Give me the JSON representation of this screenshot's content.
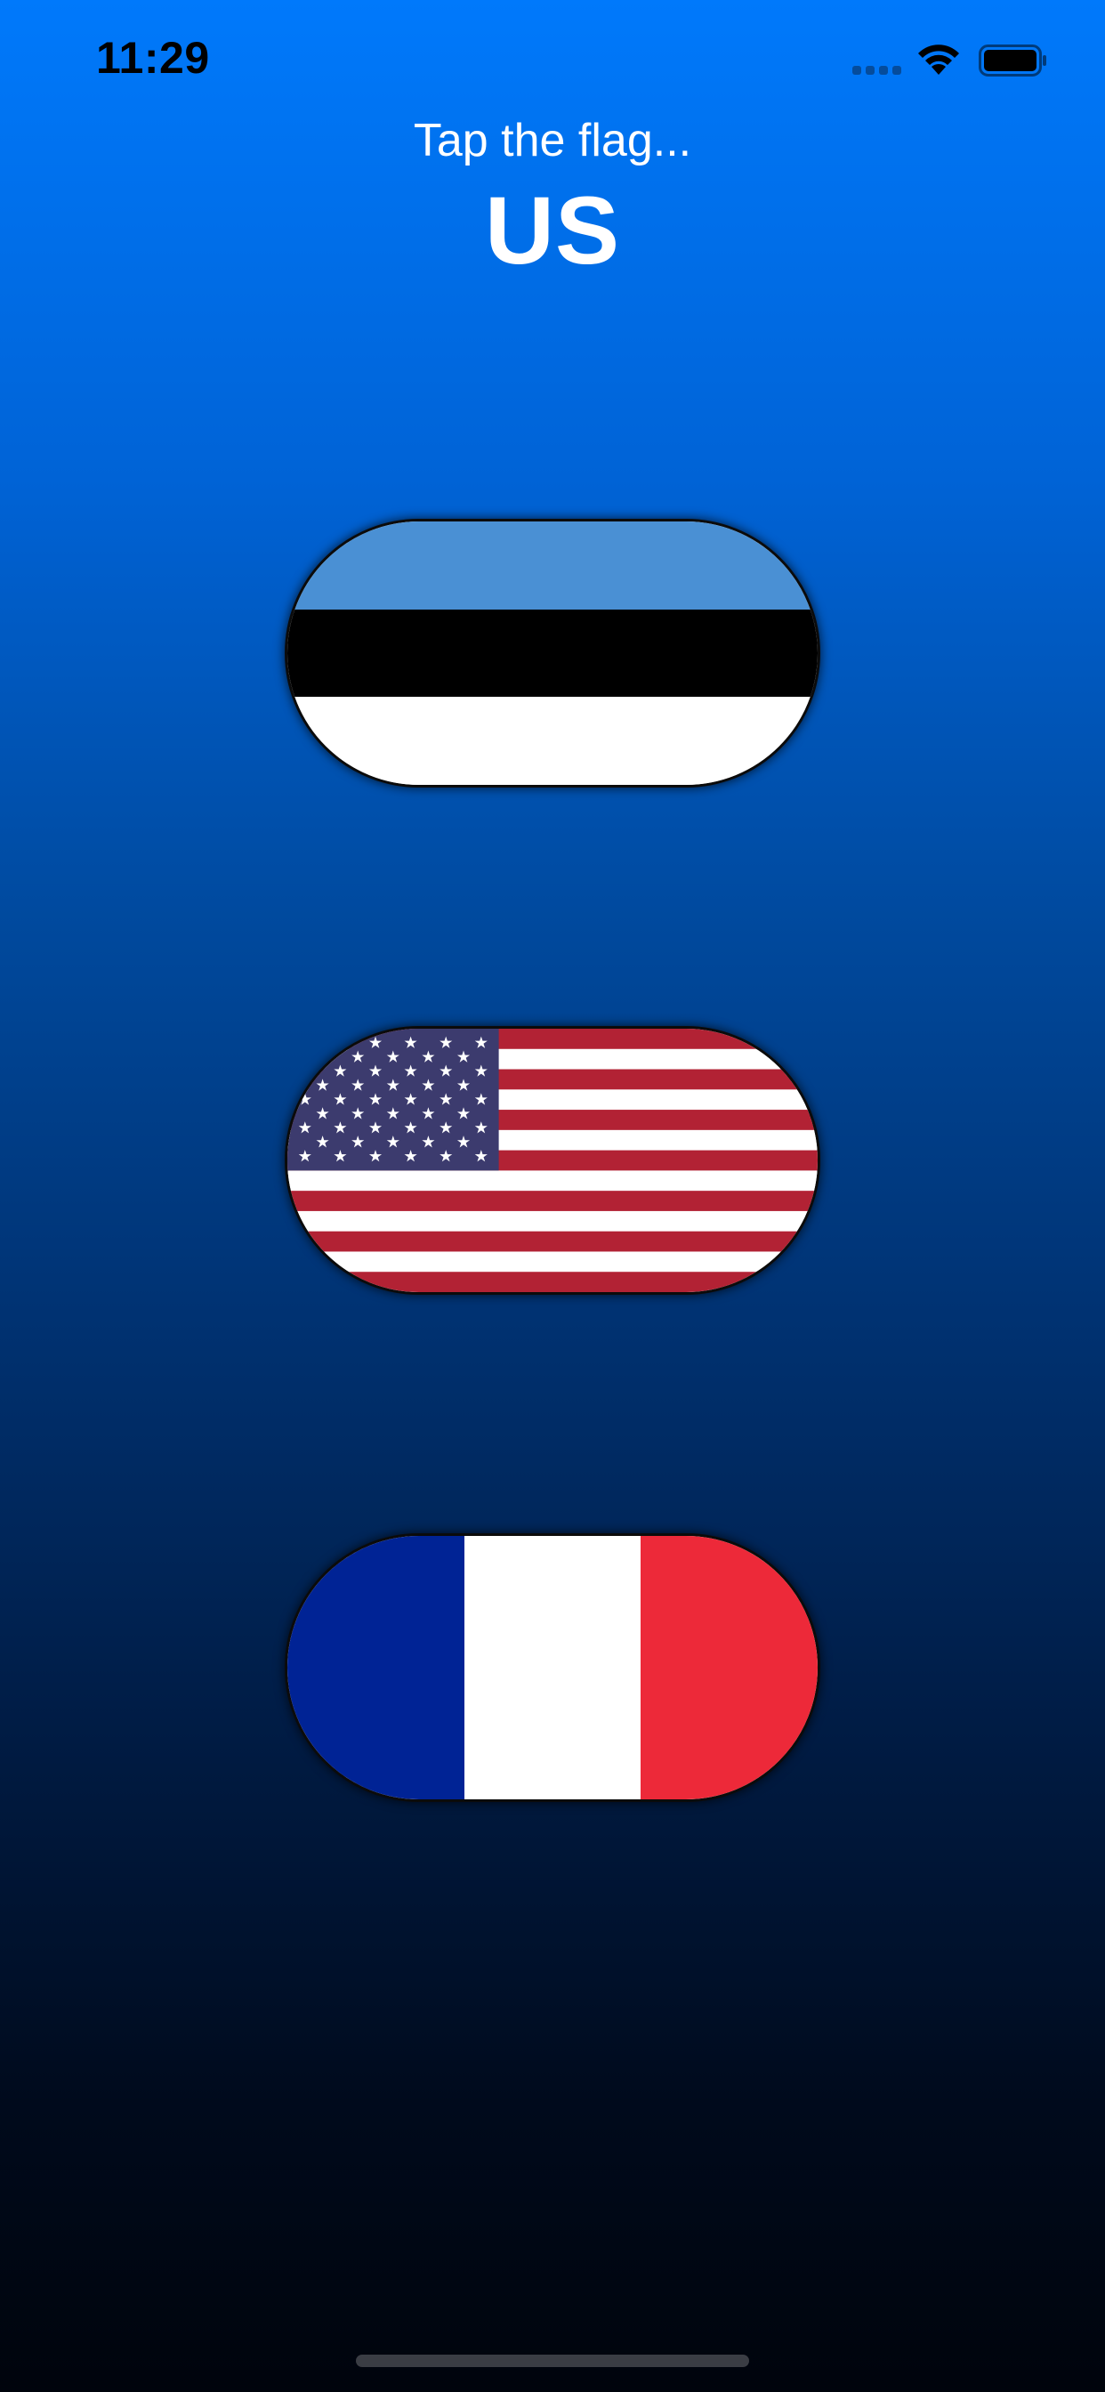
{
  "status_bar": {
    "time": "11:29",
    "icons": [
      "cellular-signal-icon",
      "wifi-icon",
      "battery-icon"
    ]
  },
  "header": {
    "prompt": "Tap the flag...",
    "country": "US"
  },
  "flags": [
    {
      "country": "Estonia",
      "colors": [
        "#4a90d4",
        "#000000",
        "#ffffff"
      ]
    },
    {
      "country": "US",
      "colors": [
        "#b22234",
        "#ffffff",
        "#3c3b6e"
      ]
    },
    {
      "country": "France",
      "colors": [
        "#002395",
        "#ffffff",
        "#ed2939"
      ]
    }
  ],
  "colors": {
    "gradient_top": "#0079fb",
    "gradient_bottom": "#00040c",
    "text": "#ffffff"
  }
}
